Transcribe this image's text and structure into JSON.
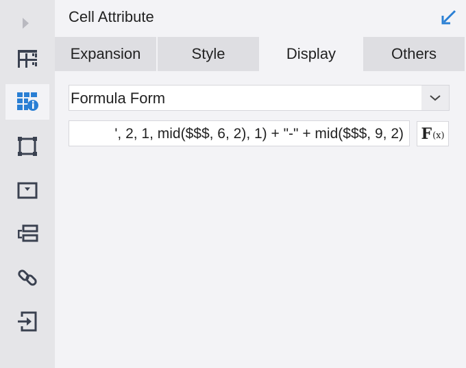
{
  "panel": {
    "title": "Cell Attribute"
  },
  "tabs": [
    {
      "label": "Expansion",
      "active": false
    },
    {
      "label": "Style",
      "active": false
    },
    {
      "label": "Display",
      "active": true
    },
    {
      "label": "Others",
      "active": false
    }
  ],
  "display": {
    "mode_select": {
      "value": "Formula Form"
    },
    "formula": {
      "value": "', 2, 1, mid($$$, 6, 2), 1) + \"-\" + mid($$$, 9, 2)"
    },
    "fx_button": {
      "label": "F",
      "sub": "(x)"
    }
  },
  "sidebar": {
    "items": [
      {
        "icon": "cell-element-icon",
        "active": false
      },
      {
        "icon": "cell-attribute-icon",
        "active": true
      },
      {
        "icon": "float-element-icon",
        "active": false
      },
      {
        "icon": "widget-settings-icon",
        "active": false
      },
      {
        "icon": "condition-attribute-icon",
        "active": false
      },
      {
        "icon": "hyperlink-icon",
        "active": false
      },
      {
        "icon": "data-entry-icon",
        "active": false
      }
    ]
  },
  "colors": {
    "accent": "#2a7fd4",
    "icon": "#3a4150",
    "sidebar_bg": "#e5e5e8",
    "panel_bg": "#f3f3f6"
  }
}
